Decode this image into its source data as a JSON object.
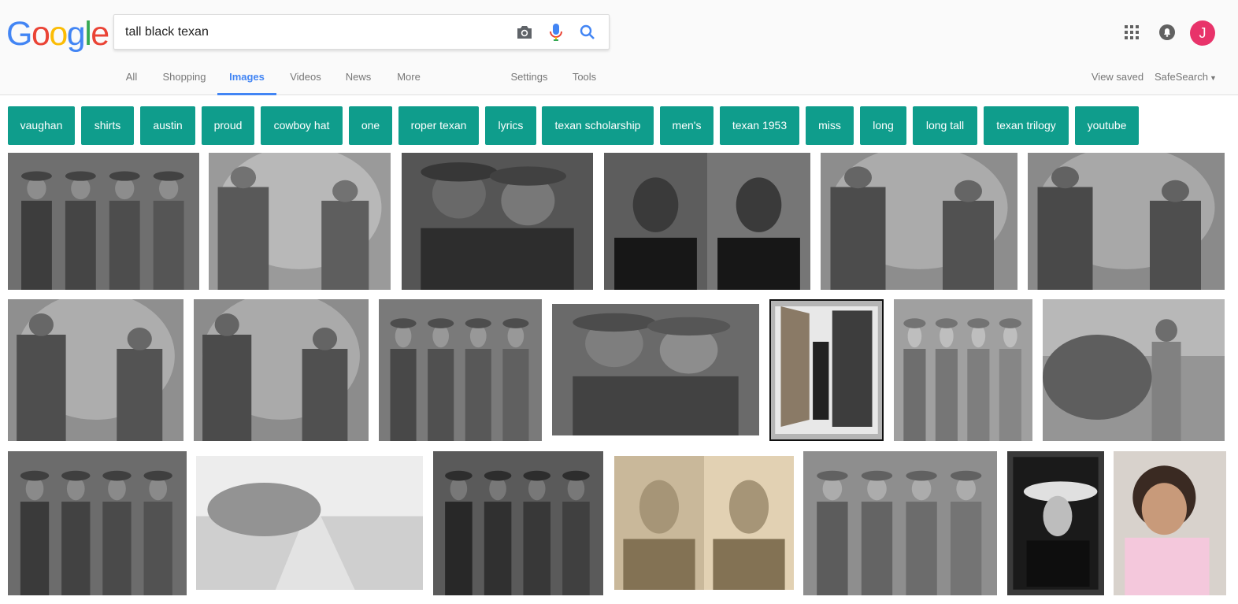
{
  "logo": {
    "letters": [
      "G",
      "o",
      "o",
      "g",
      "l",
      "e"
    ],
    "colors": [
      "#4285F4",
      "#EA4335",
      "#FBBC05",
      "#4285F4",
      "#34A853",
      "#EA4335"
    ]
  },
  "search": {
    "value": "tall black texan",
    "placeholder": ""
  },
  "icons": {
    "camera": "camera-icon",
    "mic": "microphone-icon",
    "search": "search-icon",
    "apps": "apps-grid-icon",
    "notifications": "notifications-bell-icon"
  },
  "account": {
    "initial": "J",
    "color": "#e8336a"
  },
  "tabs": [
    {
      "label": "All"
    },
    {
      "label": "Shopping"
    },
    {
      "label": "Images",
      "active": true
    },
    {
      "label": "Videos"
    },
    {
      "label": "News"
    },
    {
      "label": "More"
    },
    {
      "label": "Settings"
    },
    {
      "label": "Tools"
    }
  ],
  "right_links": {
    "view_saved": "View saved",
    "safesearch": "SafeSearch"
  },
  "chips": [
    "vaughan",
    "shirts",
    "austin",
    "proud",
    "cowboy hat",
    "one",
    "roper texan",
    "lyrics",
    "texan scholarship",
    "men's",
    "texan 1953",
    "miss",
    "long",
    "long tall",
    "texan trilogy",
    "youtube"
  ],
  "accent_colors": {
    "chip_bg": "#0f9d8c",
    "active_tab": "#4285f4"
  },
  "images": [
    {
      "tone": "#6f6f6f",
      "subject": "group"
    },
    {
      "tone": "#9a9a9a",
      "subject": "rock"
    },
    {
      "tone": "#555555",
      "subject": "two-men"
    },
    {
      "tone": "#5d5d5d",
      "subject": "mugshot"
    },
    {
      "tone": "#8d8d8d",
      "subject": "rock"
    },
    {
      "tone": "#8a8a8a",
      "subject": "rock"
    },
    {
      "tone": "#8f8f8f",
      "subject": "rock"
    },
    {
      "tone": "#8c8c8c",
      "subject": "rock"
    },
    {
      "tone": "#7a7a7a",
      "subject": "group"
    },
    {
      "tone": "#6a6a6a",
      "subject": "two-men"
    },
    {
      "tone": "#b5b5b5",
      "subject": "door",
      "selected": true
    },
    {
      "tone": "#a0a0a0",
      "subject": "group"
    },
    {
      "tone": "#959595",
      "subject": "horse"
    },
    {
      "tone": "#6c6c6c",
      "subject": "group"
    },
    {
      "tone": "#cfcfcf",
      "subject": "path"
    },
    {
      "tone": "#5a5a5a",
      "subject": "group"
    },
    {
      "tone": "#c9b89a",
      "subject": "mugshot"
    },
    {
      "tone": "#8e8e8e",
      "subject": "group"
    },
    {
      "tone": "#3a3a3a",
      "subject": "portrait"
    },
    {
      "tone": "#e6cbb8",
      "subject": "child"
    }
  ]
}
